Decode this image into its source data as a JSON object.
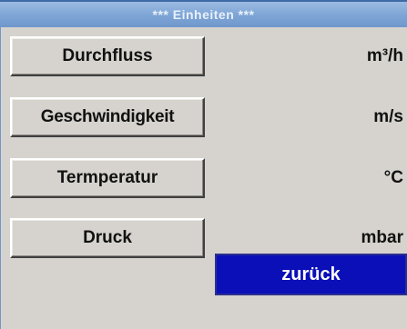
{
  "window": {
    "title": "*** Einheiten ***"
  },
  "rows": [
    {
      "button_label": "Durchfluss",
      "unit": "m³/h"
    },
    {
      "button_label": "Geschwindigkeit",
      "unit": "m/s"
    },
    {
      "button_label": "Termperatur",
      "unit": "°C"
    },
    {
      "button_label": "Druck",
      "unit": "mbar"
    }
  ],
  "footer": {
    "back_label": "zurück"
  },
  "colors": {
    "titlebar": "#7fa6d6",
    "panel": "#d6d3ce",
    "back_button": "#0a0fb8"
  }
}
